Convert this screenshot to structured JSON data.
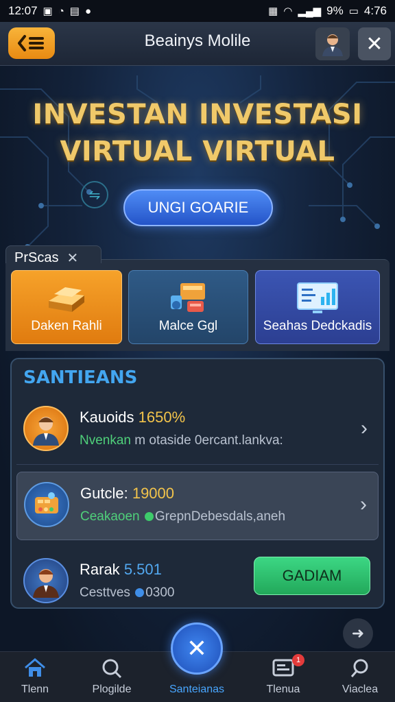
{
  "status_bar": {
    "time_left": "12:07",
    "battery": "9%",
    "time_right": "4:76"
  },
  "header": {
    "title": "Beainys Molile"
  },
  "hero": {
    "title_line1": "INVESTAN INVESTASI",
    "title_line2": "VIRTUAL VIRTUAL",
    "cta_label": "UNGI GOARIE"
  },
  "tab": {
    "label": "PrScas"
  },
  "feature_cards": [
    {
      "label": "Daken Rahli",
      "icon": "gold-bar-icon"
    },
    {
      "label": "Malce Ggl",
      "icon": "devices-icon"
    },
    {
      "label": "Seahas Dedckadis",
      "icon": "dashboard-icon"
    }
  ],
  "savings": {
    "title": "SANTIEANS",
    "rows": [
      {
        "name": "Kauoids",
        "amount": "1650%",
        "subtitle_green": "Nvenkan",
        "subtitle_rest": " m otaside 0ercant.lankva:"
      },
      {
        "name": "Gutcle:",
        "amount": "19000",
        "subtitle_green": "Ceakaoen",
        "subtitle_rest": "GrepnDebesdals,aneh"
      },
      {
        "name": "Rarak",
        "amount": "5.501",
        "subtitle_green": "Cesttves",
        "subtitle_rest": "0300",
        "action_label": "GADIAM"
      }
    ]
  },
  "bottom_nav": {
    "items": [
      {
        "label": "Tlenn"
      },
      {
        "label": "Plogilde"
      },
      {
        "label": "Santeianas"
      },
      {
        "label": "Tlenua"
      },
      {
        "label": "Viaclea"
      }
    ],
    "badge": "1"
  },
  "colors": {
    "accent_orange": "#f6a22a",
    "accent_blue": "#43a6f0",
    "accent_green": "#3cd784",
    "gold_text": "#f0c96a"
  }
}
